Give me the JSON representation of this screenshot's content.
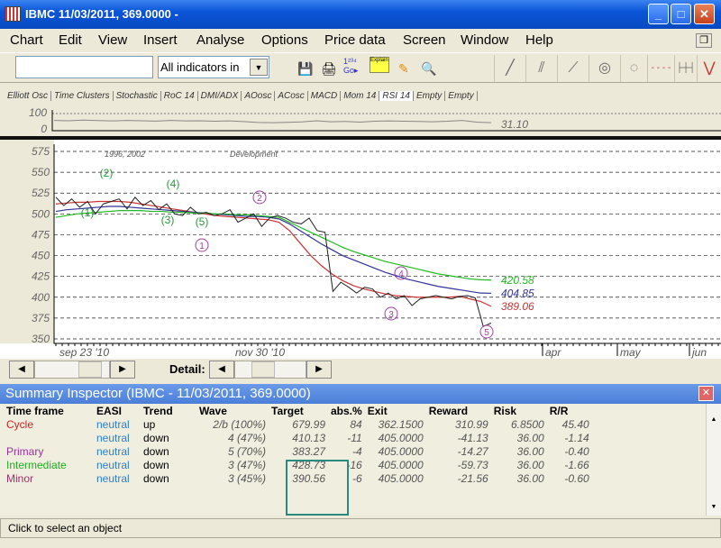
{
  "window": {
    "title": "IBMC  11/03/2011, 369.0000 -"
  },
  "menu": [
    "Chart",
    "Edit",
    "View",
    "Insert",
    "Analyse",
    "Options",
    "Price data",
    "Screen",
    "Window",
    "Help"
  ],
  "toolbar": {
    "search_value": "",
    "indicator_select": "All indicators in",
    "explain_label": "Explain"
  },
  "tabs": [
    "Elliott Osc",
    "Time Clusters",
    "Stochastic",
    "RoC 14",
    "DMI/ADX",
    "AOosc",
    "ACosc",
    "MACD",
    "Mom 14",
    "RSI 14",
    "Empty",
    "Empty"
  ],
  "active_tab": "RSI 14",
  "rsi": {
    "ticks": [
      "100",
      "0"
    ],
    "value": "31.10",
    "values": [
      60,
      58,
      62,
      59,
      57,
      60,
      58,
      56,
      60,
      57,
      58,
      55,
      57,
      53,
      48,
      47,
      49,
      51,
      58,
      52,
      54,
      50,
      55,
      57,
      55,
      54,
      52,
      55,
      60,
      50,
      47
    ]
  },
  "chart": {
    "y_ticks": [
      "575",
      "550",
      "525",
      "500",
      "475",
      "450",
      "425",
      "400",
      "375",
      "350"
    ],
    "ylim": [
      350,
      575
    ],
    "annotations": [
      "1996, 2002",
      "Development"
    ],
    "x_labels": [
      "sep 23 '10",
      "nov 30 '10",
      "apr",
      "may",
      "jun"
    ],
    "price": [
      520,
      510,
      518,
      508,
      515,
      500,
      512,
      515,
      518,
      506,
      520,
      510,
      516,
      505,
      512,
      500,
      498,
      508,
      500,
      502,
      498,
      500,
      505,
      490,
      495,
      500,
      485,
      495,
      498,
      495,
      490,
      488,
      495,
      480,
      478,
      407,
      418,
      412,
      405,
      412,
      410,
      400,
      405,
      398,
      402,
      390,
      398,
      400,
      402,
      400,
      398,
      401,
      402,
      399,
      365,
      369
    ],
    "series": [
      {
        "color": "#cc3333",
        "label": "389.06",
        "values": [
          512,
          513,
          514,
          514,
          515,
          515,
          515,
          514,
          512,
          510,
          508,
          506,
          504,
          502,
          500,
          498,
          497,
          496,
          495,
          494,
          493,
          490,
          480,
          465,
          450,
          438,
          428,
          420,
          414,
          410,
          407,
          404,
          402,
          401,
          400,
          400,
          400,
          400,
          401,
          398,
          395,
          389.06
        ]
      },
      {
        "color": "#333399",
        "label": "404.85",
        "values": [
          503,
          505,
          506,
          507,
          508,
          509,
          509,
          508,
          507,
          506,
          505,
          504,
          503,
          502,
          501,
          500,
          499,
          498,
          497,
          497,
          496,
          494,
          488,
          480,
          472,
          464,
          457,
          450,
          445,
          440,
          435,
          430,
          426,
          422,
          419,
          416,
          413,
          411,
          409,
          407,
          405,
          404.85
        ]
      },
      {
        "color": "#22bb22",
        "label": "420.58",
        "values": [
          496,
          498,
          500,
          501,
          502,
          503,
          504,
          504,
          504,
          503,
          503,
          502,
          502,
          501,
          501,
          500,
          500,
          499,
          499,
          498,
          497,
          496,
          490,
          484,
          478,
          472,
          466,
          460,
          455,
          451,
          447,
          443,
          440,
          437,
          434,
          431,
          428,
          426,
          424,
          422,
          421,
          420.58
        ]
      }
    ],
    "wave_labels_minor": [
      "(1)",
      "(2)",
      "(3)",
      "(4)",
      "(5)"
    ],
    "wave_labels_primary": [
      "1",
      "2",
      "3",
      "4",
      "5"
    ],
    "detail_label": "Detail:"
  },
  "inspector": {
    "title": "Summary Inspector (IBMC - 11/03/2011, 369.0000)",
    "columns": [
      "Time frame",
      "EASI",
      "Trend",
      "Wave",
      "Target",
      "abs.%",
      "Exit",
      "Reward",
      "Risk",
      "R/R"
    ],
    "rows": [
      {
        "tf": "Cycle",
        "color": "#cc2222",
        "easi": "neutral",
        "trend": "up",
        "wave": "2/b (100%)",
        "target": "679.99",
        "abs": "84",
        "exit": "362.1500",
        "reward": "310.99",
        "risk": "6.8500",
        "rr": "45.40"
      },
      {
        "tf": "",
        "color": "#000",
        "easi": "neutral",
        "trend": "down",
        "wave": "4 (47%)",
        "target": "410.13",
        "abs": "-11",
        "exit": "405.0000",
        "reward": "-41.13",
        "risk": "36.00",
        "rr": "-1.14"
      },
      {
        "tf": "Primary",
        "color": "#993399",
        "easi": "neutral",
        "trend": "down",
        "wave": "5 (70%)",
        "target": "383.27",
        "abs": "-4",
        "exit": "405.0000",
        "reward": "-14.27",
        "risk": "36.00",
        "rr": "-0.40"
      },
      {
        "tf": "Intermediate",
        "color": "#22aa22",
        "easi": "neutral",
        "trend": "down",
        "wave": "3 (47%)",
        "target": "428.73",
        "abs": "-16",
        "exit": "405.0000",
        "reward": "-59.73",
        "risk": "36.00",
        "rr": "-1.66"
      },
      {
        "tf": "Minor",
        "color": "#993366",
        "easi": "neutral",
        "trend": "down",
        "wave": "3 (45%)",
        "target": "390.56",
        "abs": "-6",
        "exit": "405.0000",
        "reward": "-21.56",
        "risk": "36.00",
        "rr": "-0.60"
      }
    ],
    "easi_color": "#2a7fcc",
    "highlight_color": "#2a8a80"
  },
  "status": "Click to select an object"
}
